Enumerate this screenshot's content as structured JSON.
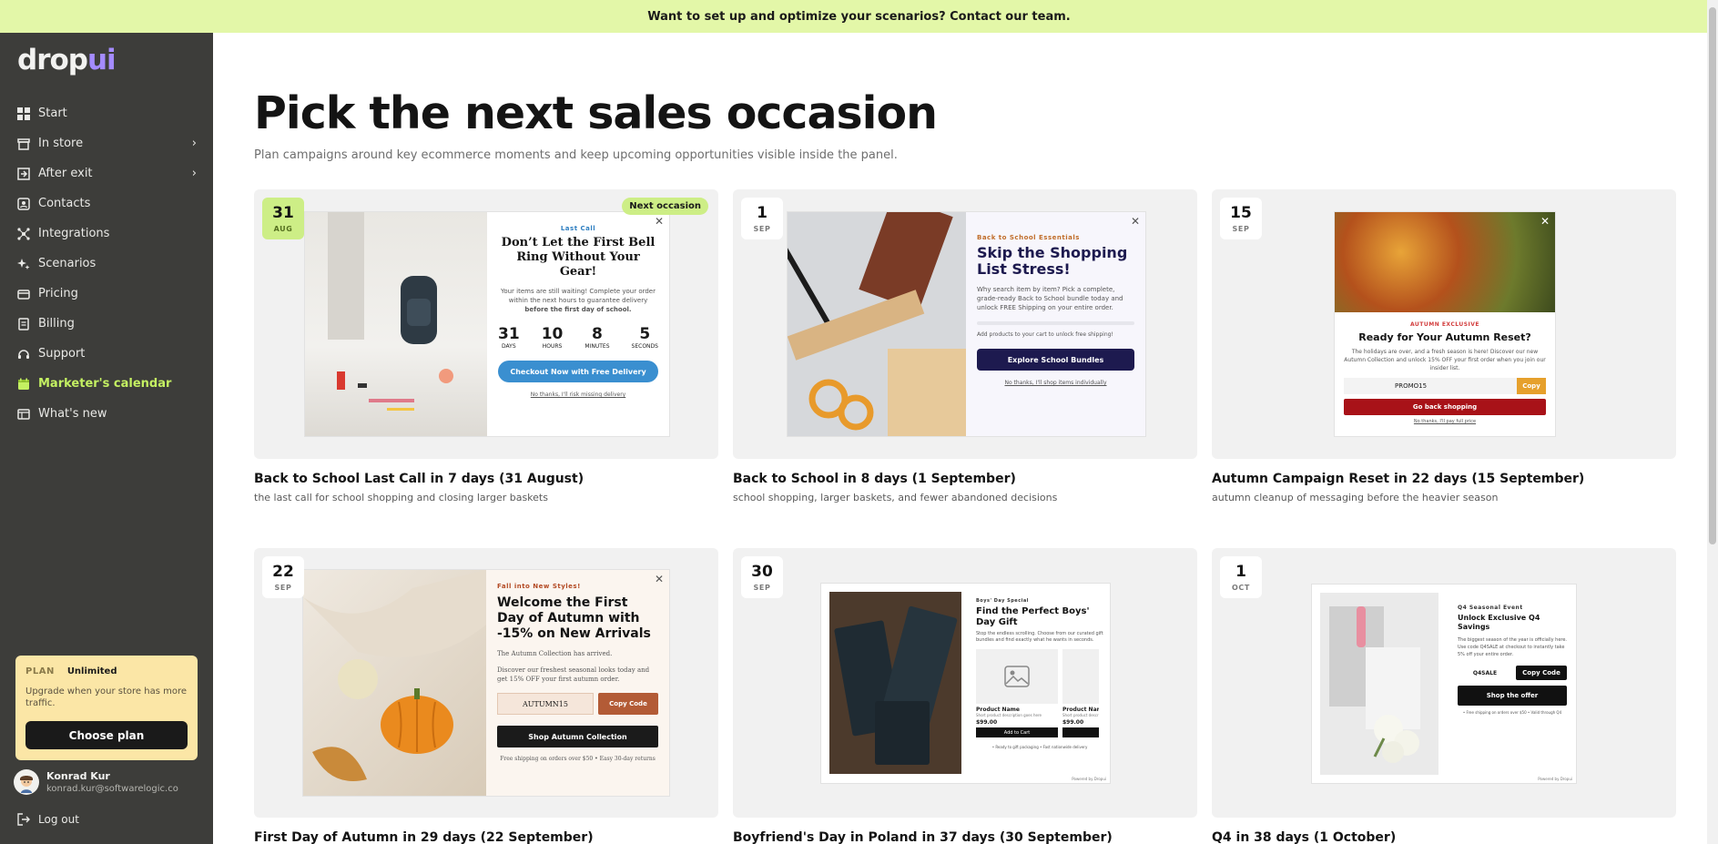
{
  "banner": {
    "text": "Want to set up and optimize your scenarios? Contact our team."
  },
  "brand": {
    "logo_main": "drop",
    "logo_accent": "ui"
  },
  "sidebar": {
    "items": [
      {
        "label": "Start",
        "icon": "grid-icon"
      },
      {
        "label": "In store",
        "icon": "store-icon",
        "has_submenu": true
      },
      {
        "label": "After exit",
        "icon": "exit-icon",
        "has_submenu": true
      },
      {
        "label": "Contacts",
        "icon": "contacts-icon"
      },
      {
        "label": "Integrations",
        "icon": "integrations-icon"
      },
      {
        "label": "Scenarios",
        "icon": "sparkle-icon"
      },
      {
        "label": "Pricing",
        "icon": "pricing-icon"
      },
      {
        "label": "Billing",
        "icon": "billing-icon"
      },
      {
        "label": "Support",
        "icon": "support-icon"
      },
      {
        "label": "Marketer's calendar",
        "icon": "calendar-icon",
        "active": true
      },
      {
        "label": "What's new",
        "icon": "news-icon"
      }
    ],
    "plan": {
      "label": "PLAN",
      "value": "Unlimited",
      "description": "Upgrade when your store has more traffic.",
      "button": "Choose plan"
    },
    "user": {
      "name": "Konrad Kur",
      "email": "konrad.kur@softwarelogic.co"
    },
    "logout": "Log out"
  },
  "main": {
    "title": "Pick the next sales occasion",
    "subtitle": "Plan campaigns around key ecommerce moments and keep upcoming opportunities visible inside the panel.",
    "next_tag": "Next occasion",
    "cards": [
      {
        "day": "31",
        "month": "AUG",
        "title": "Back to School Last Call in 7 days (31 August)",
        "description": "the last call for school shopping and closing larger baskets",
        "popup": {
          "kicker": "Last Call",
          "heading": "Don’t Let the First Bell Ring Without Your Gear!",
          "body": "Your items are still waiting! Complete your order within the next hours to guarantee delivery",
          "body_bold": "before the first day of school.",
          "countdown": [
            {
              "value": "31",
              "unit": "DAYS"
            },
            {
              "value": "10",
              "unit": "HOURS"
            },
            {
              "value": "8",
              "unit": "MINUTES"
            },
            {
              "value": "5",
              "unit": "SECONDS"
            }
          ],
          "button": "Checkout Now with Free Delivery",
          "link": "No thanks, I'll risk missing delivery"
        }
      },
      {
        "day": "1",
        "month": "SEP",
        "title": "Back to School in 8 days (1 September)",
        "description": "school shopping, larger baskets, and fewer abandoned decisions",
        "popup": {
          "kicker": "Back to School Essentials",
          "heading": "Skip the Shopping List Stress!",
          "body": "Why search item by item? Pick a complete, grade-ready Back to School bundle today and unlock FREE Shipping on your entire order.",
          "progress_text": "Add products to your cart to unlock free shipping!",
          "button": "Explore School Bundles",
          "link": "No thanks, I'll shop items individually"
        }
      },
      {
        "day": "15",
        "month": "SEP",
        "title": "Autumn Campaign Reset in 22 days (15 September)",
        "description": "autumn cleanup of messaging before the heavier season",
        "popup": {
          "kicker": "AUTUMN EXCLUSIVE",
          "heading": "Ready for Your Autumn Reset?",
          "body": "The holidays are over, and a fresh season is here! Discover our new Autumn Collection and unlock 15% OFF your first order when you join our insider list.",
          "code": "PROMO15",
          "copy": "Copy",
          "button": "Go back shopping",
          "link": "No thanks, I'll pay full price"
        }
      },
      {
        "day": "22",
        "month": "SEP",
        "title": "First Day of Autumn in 29 days (22 September)",
        "description": "",
        "popup": {
          "kicker": "Fall into New Styles!",
          "heading": "Welcome the First Day of Autumn with -15% on New Arrivals",
          "body1": "The Autumn Collection has arrived.",
          "body2": "Discover our freshest seasonal looks today and get 15% OFF your first autumn order.",
          "code": "AUTUMN15",
          "copy": "Copy Code",
          "button": "Shop Autumn Collection",
          "footer": "Free shipping on orders over $50 • Easy 30-day returns"
        }
      },
      {
        "day": "30",
        "month": "SEP",
        "title": "Boyfriend's Day in Poland in 37 days (30 September)",
        "description": "",
        "popup": {
          "kicker": "Boys' Day Special",
          "heading": "Find the Perfect Boys' Day Gift",
          "body": "Stop the endless scrolling. Choose from our curated gift bundles and find exactly what he wants in seconds.",
          "product_name": "Product Name",
          "product_desc": "Short product description goes here",
          "product_price": "$99.00",
          "product_btn": "Add to Cart",
          "footer": "• Ready to gift packaging • Fast nationwide delivery",
          "powered": "Powered by Dropui"
        }
      },
      {
        "day": "1",
        "month": "OCT",
        "title": "Q4 in 38 days (1 October)",
        "description": "",
        "popup": {
          "kicker": "Q4 Seasonal Event",
          "heading": "Unlock Exclusive Q4 Savings",
          "body": "The biggest season of the year is officially here. Use code Q4SALE at checkout to instantly take 5% off your entire order.",
          "code": "Q4SALE",
          "copy": "Copy Code",
          "button": "Shop the offer",
          "footer": "• Free shipping on orders over $50 • Valid through Q4",
          "powered": "Powered by Dropui"
        }
      }
    ]
  },
  "colors": {
    "banner": "#e3f7a8",
    "sidebar": "#3d3d3a",
    "active": "#c4f062",
    "plan": "#fbe6a6"
  }
}
